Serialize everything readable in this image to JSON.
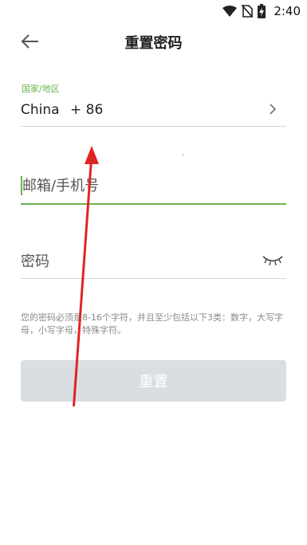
{
  "status_bar": {
    "time": "2:40",
    "icons": [
      "wifi-icon",
      "no-sim-icon",
      "battery-charging-icon"
    ]
  },
  "header": {
    "title": "重置密码",
    "back_icon": "arrow-left-icon"
  },
  "country": {
    "label": "国家/地区",
    "name": "China",
    "code": "+ 86",
    "chevron_icon": "chevron-right-icon"
  },
  "email": {
    "placeholder": "邮箱/手机号",
    "value": ""
  },
  "password": {
    "placeholder": "密码",
    "value": "",
    "toggle_icon": "eye-closed-icon"
  },
  "hint": {
    "text": "您的密码必须是8-16个字符，并且至少包括以下3类：数字，大写字母，小写字母，特殊字符。"
  },
  "reset_button": {
    "label": "重置"
  },
  "colors": {
    "accent": "#6cb34f",
    "annotation": "#e02424",
    "button_disabled": "#d9dfe1"
  },
  "annotation": {
    "icon": "red-arrow-icon"
  }
}
